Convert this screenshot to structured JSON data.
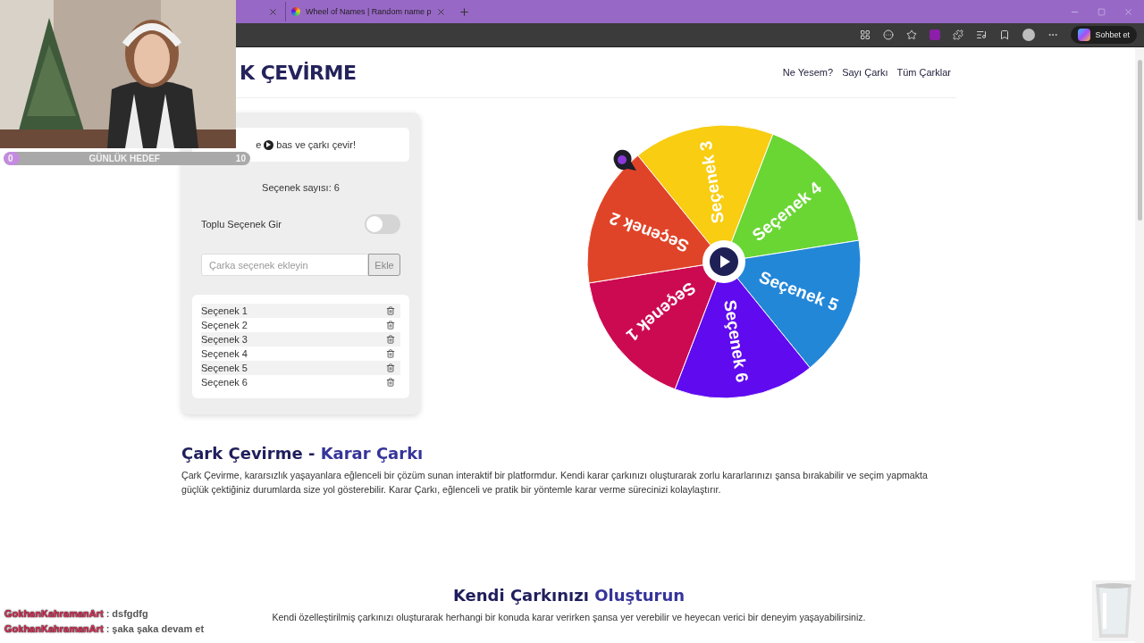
{
  "browser": {
    "tabs": [
      {
        "title": "Wheel of Names | Random name p",
        "selected": false
      }
    ],
    "chat_button": "Sohbet et"
  },
  "header": {
    "logo": "K ÇEVİRME",
    "nav": [
      "Ne Yesem?",
      "Sayı Çarkı",
      "Tüm Çarklar"
    ]
  },
  "panel": {
    "instruction_prefix": "e",
    "instruction": "bas ve çarkı çevir!",
    "count": "Seçenek sayısı: 6",
    "bulk_toggle": {
      "label": "Toplu Seçenek Gir",
      "on": false
    },
    "input": {
      "placeholder": "Çarka seçenek ekleyin"
    },
    "add_button": "Ekle",
    "options": [
      "Seçenek 1",
      "Seçenek 2",
      "Seçenek 3",
      "Seçenek 4",
      "Seçenek 5",
      "Seçenek 6"
    ]
  },
  "wheel": {
    "segments": [
      {
        "label": "Seçenek 3",
        "color": "#f8cd12"
      },
      {
        "label": "Seçenek 4",
        "color": "#6ad634"
      },
      {
        "label": "Seçenek 5",
        "color": "#2387d8"
      },
      {
        "label": "Seçenek 6",
        "color": "#600af0"
      },
      {
        "label": "Seçenek 1",
        "color": "#cc0a52"
      },
      {
        "label": "Seçenek 2",
        "color": "#e04428"
      }
    ]
  },
  "sections": [
    {
      "title": "Çark Çevirme - ",
      "title_accent": "Karar Çarkı",
      "text": "Çark Çevirme, kararsızlık yaşayanlara eğlenceli bir çözüm sunan interaktif bir platformdur. Kendi karar çarkınızı oluşturarak zorlu kararlarınızı şansa bırakabilir ve seçim yapmakta güçlük çektiğiniz durumlarda size yol gösterebilir. Karar Çarkı, eğlenceli ve pratik bir yöntemle karar verme sürecinizi kolaylaştırır.",
      "kind": "intro"
    },
    {
      "title": "Kendi Çarkınızı ",
      "title_accent": "Oluşturun",
      "text": "Kendi özelleştirilmiş çarkınızı oluşturarak herhangi bir konuda karar verirken şansa yer verebilir ve heyecan verici bir deneyim yaşayabilirsiniz.",
      "kind": "feature"
    }
  ],
  "stream_overlay": {
    "goal": {
      "label": "GÜNLÜK HEDEF",
      "start": "0",
      "end": "10",
      "level": 0.05
    },
    "chat": [
      {
        "user": "GokhanKahramanArt",
        "message": ": dsfgdfg"
      },
      {
        "user": "GokhanKahramanArt",
        "message": ": şaka şaka devam et"
      }
    ]
  }
}
